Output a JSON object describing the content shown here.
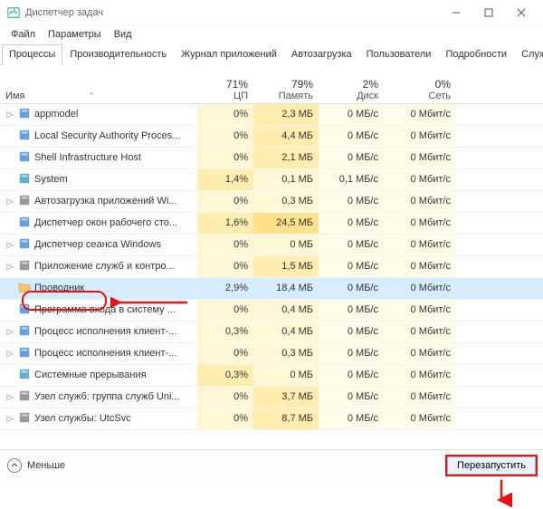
{
  "window": {
    "title": "Диспетчер задач"
  },
  "menu": {
    "file": "Файл",
    "options": "Параметры",
    "view": "Вид"
  },
  "tabs": {
    "processes": "Процессы",
    "performance": "Производительность",
    "app_history": "Журнал приложений",
    "startup": "Автозагрузка",
    "users": "Пользователи",
    "details": "Подробности",
    "services": "Службы"
  },
  "columns": {
    "name": "Имя",
    "cpu_val": "71%",
    "cpu_lbl": "ЦП",
    "mem_val": "79%",
    "mem_lbl": "Память",
    "disk_val": "2%",
    "disk_lbl": "Диск",
    "net_val": "0%",
    "net_lbl": "Сеть"
  },
  "rows": [
    {
      "exp": true,
      "icon": "app",
      "name": "appmodel",
      "cpu": "0%",
      "mem": "2,3 МБ",
      "disk": "0 МБ/с",
      "net": "0 Мбит/с",
      "cpu_h": "low",
      "mem_h": "med"
    },
    {
      "exp": false,
      "icon": "shield",
      "name": "Local Security Authority Proces...",
      "cpu": "0%",
      "mem": "4,4 МБ",
      "disk": "0 МБ/с",
      "net": "0 Мбит/с",
      "cpu_h": "low",
      "mem_h": "med"
    },
    {
      "exp": false,
      "icon": "shell",
      "name": "Shell Infrastructure Host",
      "cpu": "0%",
      "mem": "2,1 МБ",
      "disk": "0 МБ/с",
      "net": "0 Мбит/с",
      "cpu_h": "low",
      "mem_h": "med"
    },
    {
      "exp": false,
      "icon": "sys",
      "name": "System",
      "cpu": "1,4%",
      "mem": "0,1 МБ",
      "disk": "0,1 МБ/с",
      "net": "0 Мбит/с",
      "cpu_h": "med",
      "mem_h": "low"
    },
    {
      "exp": true,
      "icon": "gear",
      "name": "Автозагрузка приложений Wi...",
      "cpu": "0%",
      "mem": "0,3 МБ",
      "disk": "0 МБ/с",
      "net": "0 Мбит/с",
      "cpu_h": "low",
      "mem_h": "low"
    },
    {
      "exp": false,
      "icon": "dwm",
      "name": "Диспетчер окон рабочего сто...",
      "cpu": "1,6%",
      "mem": "24,5 МБ",
      "disk": "0 МБ/с",
      "net": "0 Мбит/с",
      "cpu_h": "med",
      "mem_h": "hi"
    },
    {
      "exp": true,
      "icon": "sess",
      "name": "Диспетчер сеанса  Windows",
      "cpu": "0%",
      "mem": "0 МБ",
      "disk": "0 МБ/с",
      "net": "0 Мбит/с",
      "cpu_h": "low",
      "mem_h": "low"
    },
    {
      "exp": true,
      "icon": "svc",
      "name": "Приложение служб и контро...",
      "cpu": "0%",
      "mem": "1,5 МБ",
      "disk": "0 МБ/с",
      "net": "0 Мбит/с",
      "cpu_h": "low",
      "mem_h": "med"
    },
    {
      "exp": false,
      "icon": "explorer",
      "name": "Проводник",
      "cpu": "2,9%",
      "mem": "18,4 МБ",
      "disk": "0 МБ/с",
      "net": "0 Мбит/с",
      "cpu_h": "hi",
      "mem_h": "hi",
      "selected": true
    },
    {
      "exp": false,
      "icon": "logon",
      "name": "Программа входа в систему ...",
      "cpu": "0%",
      "mem": "0,4 МБ",
      "disk": "0 МБ/с",
      "net": "0 Мбит/с",
      "cpu_h": "low",
      "mem_h": "low"
    },
    {
      "exp": true,
      "icon": "csrss",
      "name": "Процесс исполнения клиент-...",
      "cpu": "0,3%",
      "mem": "0,4 МБ",
      "disk": "0 МБ/с",
      "net": "0 Мбит/с",
      "cpu_h": "low",
      "mem_h": "low"
    },
    {
      "exp": true,
      "icon": "csrss",
      "name": "Процесс исполнения клиент-...",
      "cpu": "0%",
      "mem": "0,3 МБ",
      "disk": "0 МБ/с",
      "net": "0 Мбит/с",
      "cpu_h": "low",
      "mem_h": "low"
    },
    {
      "exp": false,
      "icon": "sys",
      "name": "Системные прерывания",
      "cpu": "0,3%",
      "mem": "0 МБ",
      "disk": "0 МБ/с",
      "net": "0 Мбит/с",
      "cpu_h": "med",
      "mem_h": "low"
    },
    {
      "exp": true,
      "icon": "svchost",
      "name": "Узел служб: группа служб Uni...",
      "cpu": "0%",
      "mem": "3,7 МБ",
      "disk": "0 МБ/с",
      "net": "0 Мбит/с",
      "cpu_h": "low",
      "mem_h": "med"
    },
    {
      "exp": true,
      "icon": "svchost",
      "name": "Узел службы: UtcSvc",
      "cpu": "0%",
      "mem": "8,7 МБ",
      "disk": "0 МБ/с",
      "net": "0 Мбит/с",
      "cpu_h": "low",
      "mem_h": "med"
    }
  ],
  "footer": {
    "less": "Меньше",
    "restart": "Перезапустить"
  }
}
